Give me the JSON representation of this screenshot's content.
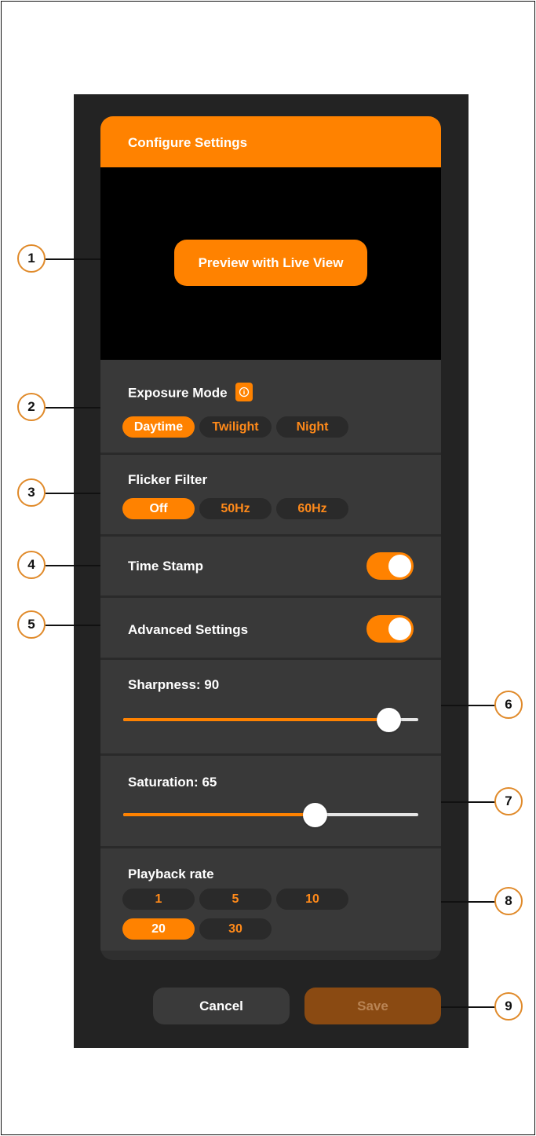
{
  "header": {
    "title": "Configure Settings"
  },
  "preview": {
    "button_label": "Preview with Live View"
  },
  "exposure": {
    "title": "Exposure Mode",
    "options": [
      "Daytime",
      "Twilight",
      "Night"
    ],
    "selected": "Daytime"
  },
  "flicker": {
    "title": "Flicker Filter",
    "options": [
      "Off",
      "50Hz",
      "60Hz"
    ],
    "selected": "Off"
  },
  "timestamp": {
    "title": "Time Stamp",
    "enabled": true
  },
  "advanced": {
    "title": "Advanced Settings",
    "enabled": true
  },
  "sharpness": {
    "label": "Sharpness: 90",
    "value": 90,
    "max": 100
  },
  "saturation": {
    "label": "Saturation: 65",
    "value": 65,
    "max": 100
  },
  "playback": {
    "title": "Playback rate",
    "options": [
      "1",
      "5",
      "10",
      "20",
      "30"
    ],
    "selected": "20"
  },
  "footer": {
    "cancel_label": "Cancel",
    "save_label": "Save"
  },
  "callouts": [
    "1",
    "2",
    "3",
    "4",
    "5",
    "6",
    "7",
    "8",
    "9"
  ],
  "colors": {
    "accent": "#ff8200",
    "panel": "#393939",
    "background": "#232323"
  }
}
